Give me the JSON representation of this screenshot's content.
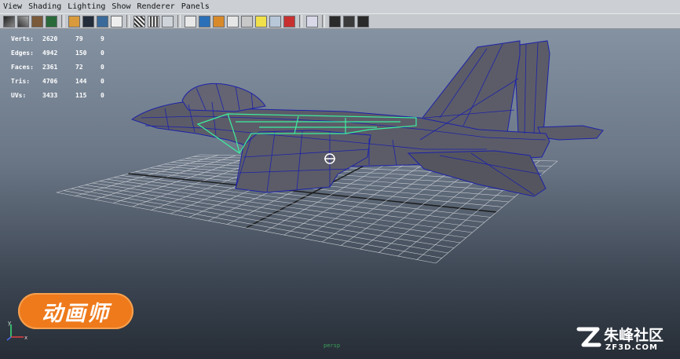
{
  "menu": [
    "View",
    "Shading",
    "Lighting",
    "Show",
    "Renderer",
    "Panels"
  ],
  "toolbar": {
    "groups": [
      [
        "camera-attributes-icon",
        "bookmark-icon",
        "image-plane-icon",
        "2d-pan-zoom-icon"
      ],
      [
        "grid-icon",
        "film-gate-icon",
        "resolution-gate-icon",
        "gate-mask-icon"
      ],
      [
        "wireframe-icon",
        "smooth-shade-icon",
        "textured-icon",
        "lights-icon",
        "shadows-icon",
        "isolate-icon"
      ],
      [
        "xray-icon",
        "xray-joints-icon",
        "xray-components-icon"
      ],
      [
        "hud-icon",
        "grid-toggle-icon",
        "render-view-icon"
      ]
    ]
  },
  "hud": {
    "rows": [
      {
        "label": "Verts:",
        "values": [
          "2620",
          "79",
          "9"
        ]
      },
      {
        "label": "Edges:",
        "values": [
          "4942",
          "150",
          "0"
        ]
      },
      {
        "label": "Faces:",
        "values": [
          "2361",
          "72",
          "0"
        ]
      },
      {
        "label": "Tris:",
        "values": [
          "4706",
          "144",
          "0"
        ]
      },
      {
        "label": "UVs:",
        "values": [
          "3433",
          "115",
          "0"
        ]
      }
    ]
  },
  "viewport": {
    "camera_label": "persp",
    "mesh_fill": "#5c5c68",
    "wire_color": "#1c22a8",
    "selection_color": "#3cf0a0",
    "grid_color": "#c8ccd2"
  },
  "overlay": {
    "logo_text": "动画师",
    "watermark_title": "朱峰社区",
    "watermark_sub": "ZF3D.COM"
  },
  "axis_gizmo": {
    "x": "x",
    "y": "y"
  }
}
